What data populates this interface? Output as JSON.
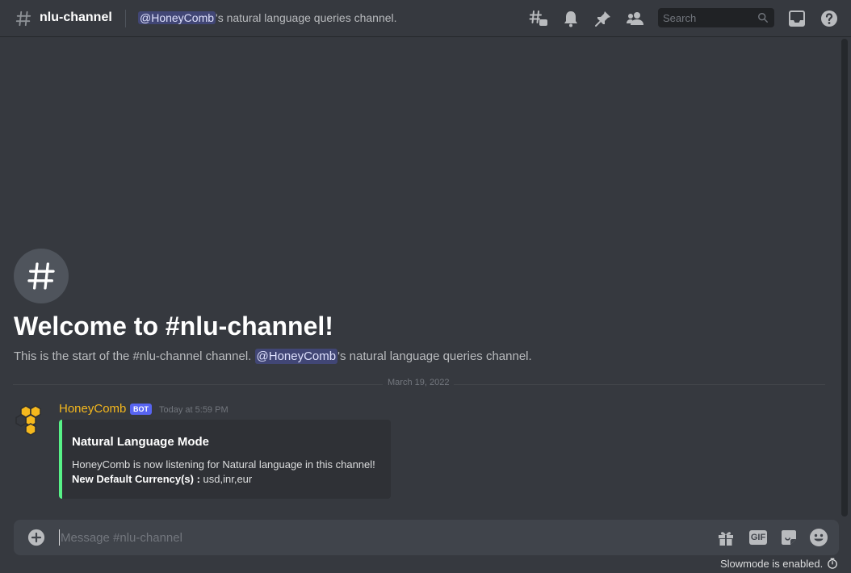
{
  "header": {
    "channel_name": "nlu-channel",
    "topic_mention": "@HoneyComb",
    "topic_rest": "'s natural language queries channel.",
    "search_placeholder": "Search",
    "icons": [
      "threads-icon",
      "bell-icon",
      "pin-icon",
      "members-icon",
      "inbox-icon",
      "help-icon"
    ]
  },
  "welcome": {
    "title": "Welcome to #nlu-channel!",
    "sub_prefix": "This is the start of the #nlu-channel channel. ",
    "sub_mention": "@HoneyComb",
    "sub_suffix": "'s natural language queries channel."
  },
  "date_divider": "March 19, 2022",
  "message": {
    "author": "HoneyComb",
    "badge": "BOT",
    "timestamp": "Today at 5:59 PM",
    "author_color": "#f5b81d",
    "embed": {
      "title": "Natural Language Mode",
      "description": "HoneyComb is now listening for Natural language in this channel!",
      "field_label": "New Default Currency(s) :",
      "field_value": " usd,inr,eur",
      "accent_color": "#57f287"
    }
  },
  "composer": {
    "placeholder": "Message #nlu-channel",
    "gif_label": "GIF",
    "icons": [
      "add-icon",
      "gift-icon",
      "gif-icon",
      "sticker-icon",
      "emoji-icon"
    ]
  },
  "footer": {
    "slowmode_text": "Slowmode is enabled.",
    "slowmode_icon": "timer-icon"
  }
}
